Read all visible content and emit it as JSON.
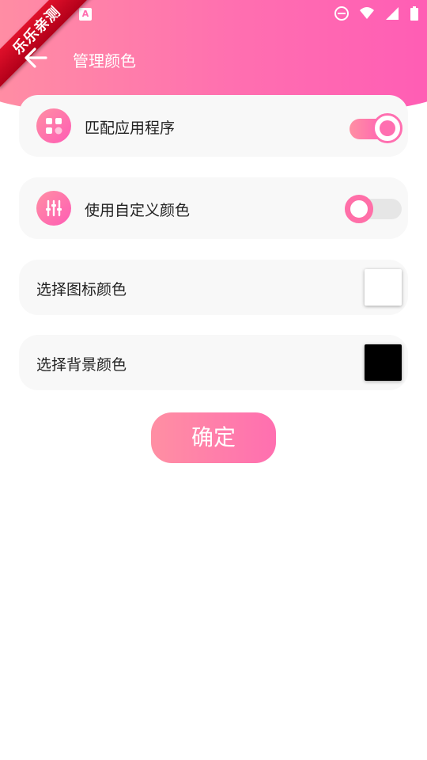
{
  "watermark": {
    "text": "乐乐亲测"
  },
  "status_bar": {
    "left_icon_glyph": "A",
    "icons": [
      "do-not-disturb-icon",
      "wifi-icon",
      "signal-icon",
      "battery-icon"
    ]
  },
  "app_bar": {
    "title": "管理颜色",
    "back_icon": "arrow-left-icon"
  },
  "settings": {
    "match_app": {
      "label": "匹配应用程序",
      "icon": "apps-grid-icon",
      "enabled": true
    },
    "custom_color": {
      "label": "使用自定义颜色",
      "icon": "sliders-icon",
      "enabled": false
    },
    "icon_color": {
      "label": "选择图标颜色",
      "swatch": "#ffffff"
    },
    "background_color": {
      "label": "选择背景颜色",
      "swatch": "#000000"
    }
  },
  "actions": {
    "confirm_label": "确定"
  },
  "theme": {
    "accent_start": "#ff8fa3",
    "accent_end": "#ff5cb5",
    "card_bg": "#f8f8f8"
  }
}
